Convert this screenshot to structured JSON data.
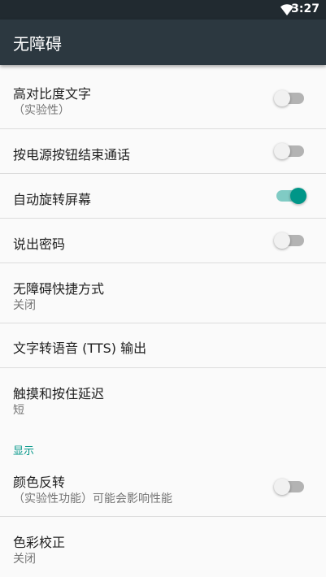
{
  "status_bar": {
    "time": "3:27",
    "icons": [
      "wifi-icon"
    ]
  },
  "app_bar": {
    "title": "无障碍"
  },
  "items": [
    {
      "label": "高对比度文字",
      "sub": "（实验性）",
      "switch": false
    },
    {
      "label": "按电源按钮结束通话",
      "switch": false
    },
    {
      "label": "自动旋转屏幕",
      "switch": true
    },
    {
      "label": "说出密码",
      "switch": false
    },
    {
      "label": "无障碍快捷方式",
      "sub": "关闭"
    },
    {
      "label": "文字转语音 (TTS) 输出"
    },
    {
      "label": "触摸和按住延迟",
      "sub": "短"
    }
  ],
  "display_section": {
    "header": "显示",
    "items": [
      {
        "label": "颜色反转",
        "sub": "（实验性功能）可能会影响性能",
        "switch": false
      },
      {
        "label": "色彩校正",
        "sub": "关闭"
      }
    ]
  },
  "colors": {
    "accent": "#009688",
    "app_bar": "#2c3840",
    "status_bar": "#212a30"
  }
}
